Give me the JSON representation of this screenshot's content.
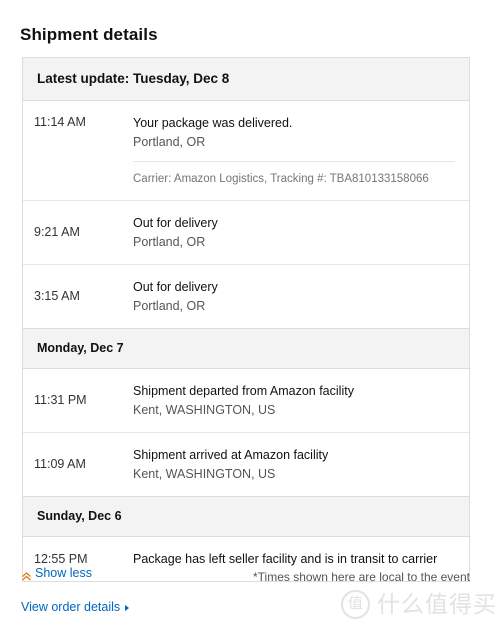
{
  "page_title": "Shipment details",
  "card": {
    "latest_update_header": "Latest update: Tuesday, Dec 8",
    "sections": [
      {
        "date_label": null,
        "events": [
          {
            "time": "11:14 AM",
            "title": "Your package was delivered.",
            "location": "Portland, OR",
            "meta": "Carrier: Amazon Logistics, Tracking #: TBA810133158066"
          },
          {
            "time": "9:21 AM",
            "title": "Out for delivery",
            "location": "Portland, OR",
            "meta": null
          },
          {
            "time": "3:15 AM",
            "title": "Out for delivery",
            "location": "Portland, OR",
            "meta": null
          }
        ]
      },
      {
        "date_label": "Monday, Dec 7",
        "events": [
          {
            "time": "11:31 PM",
            "title": "Shipment departed from Amazon facility",
            "location": "Kent, WASHINGTON, US",
            "meta": null
          },
          {
            "time": "11:09 AM",
            "title": "Shipment arrived at Amazon facility",
            "location": "Kent, WASHINGTON, US",
            "meta": null
          }
        ]
      },
      {
        "date_label": "Sunday, Dec 6",
        "events": [
          {
            "time": "12:55 PM",
            "title": "Package has left seller facility and is in transit to carrier",
            "location": null,
            "meta": null
          }
        ]
      }
    ]
  },
  "footer": {
    "show_less_label": "Show less",
    "show_less_icon": "double-caret-up-icon",
    "times_note": "*Times shown here are local to the event",
    "view_order_details_label": "View order details",
    "view_order_details_icon": "caret-right-icon"
  },
  "watermark": {
    "mark": "值",
    "text": "什么值得买"
  },
  "colors": {
    "link": "#0066c0",
    "accent_orange": "#e47911",
    "header_bg": "#f3f3f3",
    "border": "#dddddd",
    "text_primary": "#111111",
    "text_secondary": "#555555",
    "text_muted": "#767676"
  }
}
